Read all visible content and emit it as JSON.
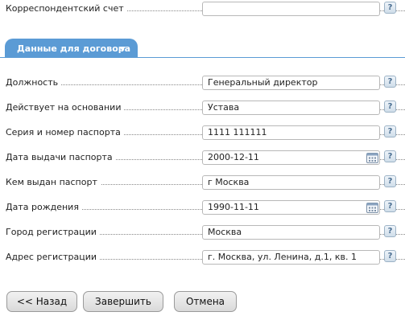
{
  "top_field": {
    "label": "Корреспондентский счет",
    "value": ""
  },
  "section": {
    "title": "Данные для договора"
  },
  "fields": [
    {
      "label": "Должность",
      "value": "Генеральный директор",
      "calendar": false
    },
    {
      "label": "Действует на основании",
      "value": "Устава",
      "calendar": false
    },
    {
      "label": "Серия и номер паспорта",
      "value": "1111 111111",
      "calendar": false
    },
    {
      "label": "Дата выдачи паспорта",
      "value": "2000-12-11",
      "calendar": true
    },
    {
      "label": "Кем выдан паспорт",
      "value": "г Москва",
      "calendar": false
    },
    {
      "label": "Дата рождения",
      "value": "1990-11-11",
      "calendar": true
    },
    {
      "label": "Город регистрации",
      "value": "Москва",
      "calendar": false
    },
    {
      "label": "Адрес регистрации",
      "value": "г. Москва, ул. Ленина, д.1, кв. 1",
      "calendar": false
    }
  ],
  "help_label": "?",
  "buttons": {
    "back": "<< Назад",
    "finish": "Завершить",
    "cancel": "Отмена"
  },
  "colors": {
    "accent": "#5b9bd5"
  },
  "icons": {
    "help": "question-mark-icon",
    "calendar": "calendar-icon",
    "dropdown": "triangle-down-icon"
  }
}
